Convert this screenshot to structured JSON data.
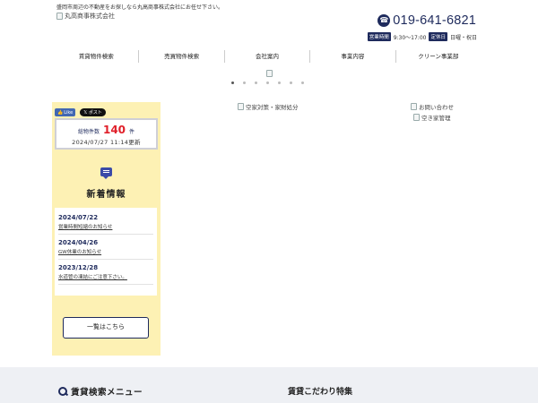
{
  "header": {
    "tagline": "盛岡市周辺の不動産をお探しなら丸高商事株式会社にお任せ下さい。",
    "logo_alt": "丸高商事株式会社",
    "phone": "019-641-6821",
    "hours_label": "営業時間",
    "hours": "9:30～17:00",
    "holiday_label": "定休日",
    "holiday": "日曜・祝日"
  },
  "nav": [
    {
      "label": "賃貸物件検索"
    },
    {
      "label": "売買物件検索"
    },
    {
      "label": "会社案内"
    },
    {
      "label": "事業内容"
    },
    {
      "label": "クリーン事業部"
    }
  ],
  "slider": {
    "dot_count": 7,
    "active_index": 0
  },
  "sidebar": {
    "fb_like": "Like",
    "x_post": "ポスト",
    "count_label": "総物件数",
    "count_value": "140",
    "count_unit": "件",
    "count_updated": "2024/07/27 11:14更新",
    "news_title": "新着情報",
    "news": [
      {
        "date": "2024/07/22",
        "title": "営業時間短縮のお知らせ"
      },
      {
        "date": "2024/04/26",
        "title": "GW休業のお知らせ"
      },
      {
        "date": "2023/12/28",
        "title": "水道管の凍結にご注意下さい。"
      }
    ],
    "more_label": "一覧はこちら"
  },
  "banners": {
    "akiya": "空家対策・家財処分",
    "contact": "お問い合わせ",
    "kanri": "空き家管理"
  },
  "bottom": {
    "menu_title": "賃貸検索メニュー",
    "feature_title": "賃貸こだわり特集"
  },
  "colors": {
    "navy": "#1e2a5c",
    "accent_red": "#e0202a",
    "side_bg": "#fdf1b4"
  }
}
